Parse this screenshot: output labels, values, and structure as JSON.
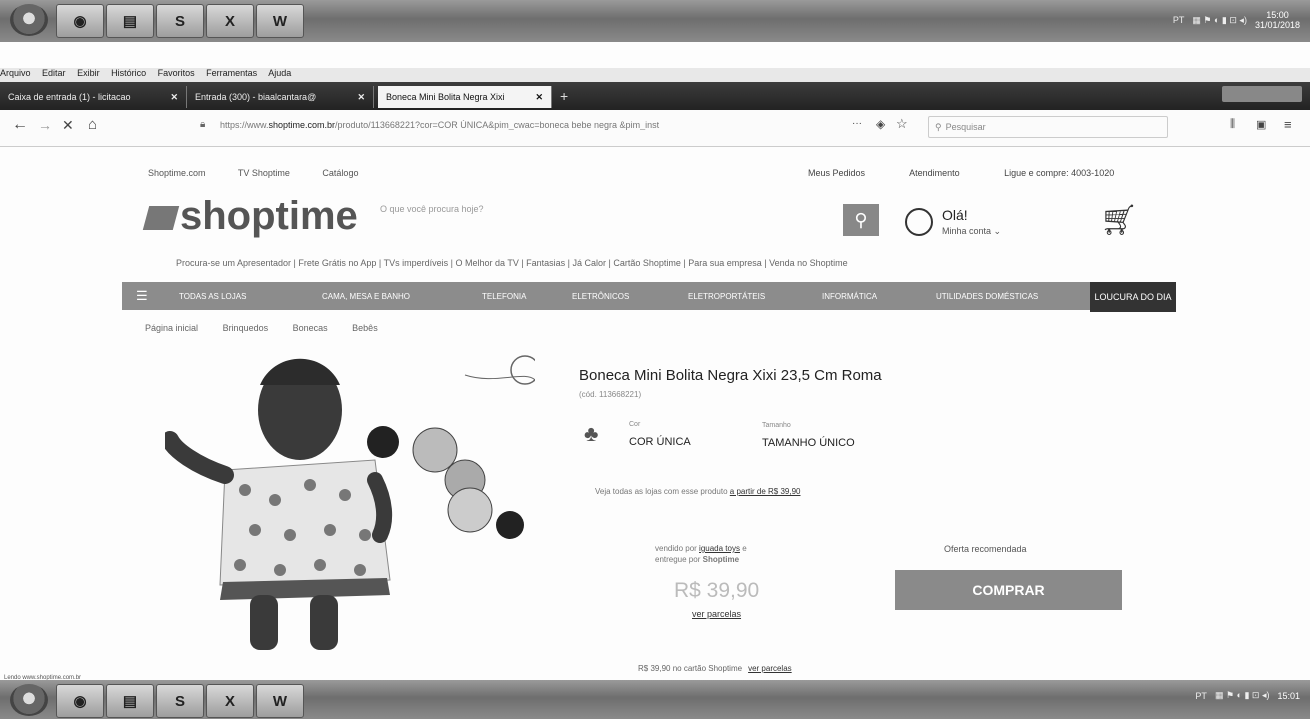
{
  "os": {
    "taskbar_top_clock": [
      "15:00",
      "31/01/2018"
    ],
    "taskbar_bottom_clock": [
      "15:01"
    ],
    "tray_text": "PT"
  },
  "browser": {
    "menu": [
      "Arquivo",
      "Editar",
      "Exibir",
      "Histórico",
      "Favoritos",
      "Ferramentas",
      "Ajuda"
    ],
    "tabs": [
      {
        "label": "Caixa de entrada (1) - licitacao"
      },
      {
        "label": "Entrada (300) - biaalcantara@"
      },
      {
        "label": "Boneca Mini Bolita Negra Xixi"
      }
    ],
    "url_prefix": "https://www.",
    "url_host": "shoptime.com.br",
    "url_rest": "/produto/113668221?cor=COR ÚNICA&pim_cwac=boneca bebe negra &pim_inst",
    "url_menu": "···",
    "search_placeholder": "Pesquisar",
    "status": "Lendo www.shoptime.com.br"
  },
  "site": {
    "toplinks": [
      "Shoptime.com",
      "TV Shoptime",
      "Catálogo"
    ],
    "rightlinks": [
      "Meus Pedidos",
      "Atendimento",
      "Ligue e compre: 4003-1020"
    ],
    "logo": "shoptime",
    "search_placeholder": "O que você procura hoje?",
    "greeting": "Olá!",
    "account": "Minha conta",
    "promo": "Procura-se um Apresentador  |  Frete Grátis no App  |  TVs imperdíveis  |  O Melhor da TV  |  Fantasias  |  Já Calor  |  Cartão Shoptime  |  Para sua empresa  |  Venda no Shoptime",
    "categories": [
      "TODAS AS LOJAS",
      "CAMA, MESA E BANHO",
      "TELEFONIA",
      "ELETRÔNICOS",
      "ELETROPORTÁTEIS",
      "INFORMÁTICA",
      "UTILIDADES DOMÉSTICAS"
    ],
    "loucura": "LOUCURA DO DIA",
    "breadcrumbs": [
      "Página inicial",
      "Brinquedos",
      "Bonecas",
      "Bebês"
    ]
  },
  "product": {
    "title": "Boneca Mini Bolita Negra Xixi 23,5 Cm Roma",
    "code": "(cód. 113668221)",
    "cor_label": "Cor",
    "cor_value": "COR ÚNICA",
    "tamanho_label": "Tamanho",
    "tamanho_value": "TAMANHO ÚNICO",
    "lojas_text": "Veja todas as lojas com esse produto",
    "lojas_link": "a partir de R$ 39,90",
    "vendido_prefix": "vendido por",
    "vendido_link": "iguada toys",
    "vendido_suffix": "e",
    "entregue": "entregue por",
    "entregue_store": "Shoptime",
    "price": "R$ 39,90",
    "ver_parcelas": "ver parcelas",
    "oferta": "Oferta recomendada",
    "comprar": "COMPRAR",
    "cartao_text": "R$ 39,90 no cartão Shoptime",
    "cartao_link": "ver parcelas"
  }
}
